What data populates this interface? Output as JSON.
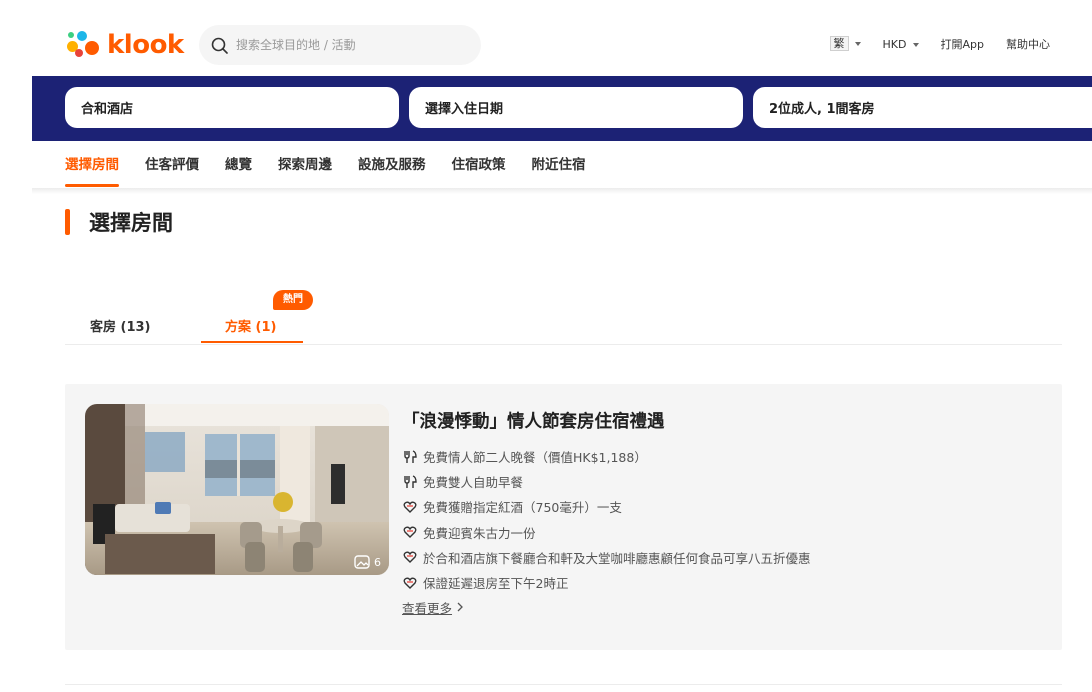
{
  "header": {
    "logo_text": "klook",
    "search_placeholder": "搜索全球目的地 / 活動",
    "lang_label": "繁",
    "currency_label": "HKD",
    "open_app_label": "打開App",
    "help_label": "幫助中心"
  },
  "booking": {
    "hotel_value": "合和酒店",
    "date_value": "選擇入住日期",
    "guests_value": "2位成人, 1間客房"
  },
  "subnav": {
    "items": [
      "選擇房間",
      "住客評價",
      "總覽",
      "探索周邊",
      "設施及服務",
      "住宿政策",
      "附近住宿"
    ],
    "active_index": 0
  },
  "section": {
    "title": "選擇房間"
  },
  "tabs": {
    "rooms_label": "客房 (13)",
    "packages_label": "方案 (1)",
    "hot_badge": "熱門"
  },
  "package": {
    "title": "「浪漫悸動」情人節套房住宿禮遇",
    "photo_count": "6",
    "perks": [
      {
        "icon": "dining-icon",
        "text": "免費情人節二人晚餐（價值HK$1,188）"
      },
      {
        "icon": "dining-icon",
        "text": "免費雙人自助早餐"
      },
      {
        "icon": "gift-heart-icon",
        "text": "免費獲贈指定紅酒（750毫升）一支"
      },
      {
        "icon": "gift-heart-icon",
        "text": "免費迎賓朱古力一份"
      },
      {
        "icon": "gift-heart-icon",
        "text": "於合和酒店旗下餐廳合和軒及大堂咖啡廳惠顧任何食品可享八五折優惠"
      },
      {
        "icon": "gift-heart-icon",
        "text": "保證延遲退房至下午2時正"
      }
    ],
    "more_label": "查看更多"
  },
  "colors": {
    "brand": "#ff5b00",
    "booking_bar": "#1c2275"
  }
}
